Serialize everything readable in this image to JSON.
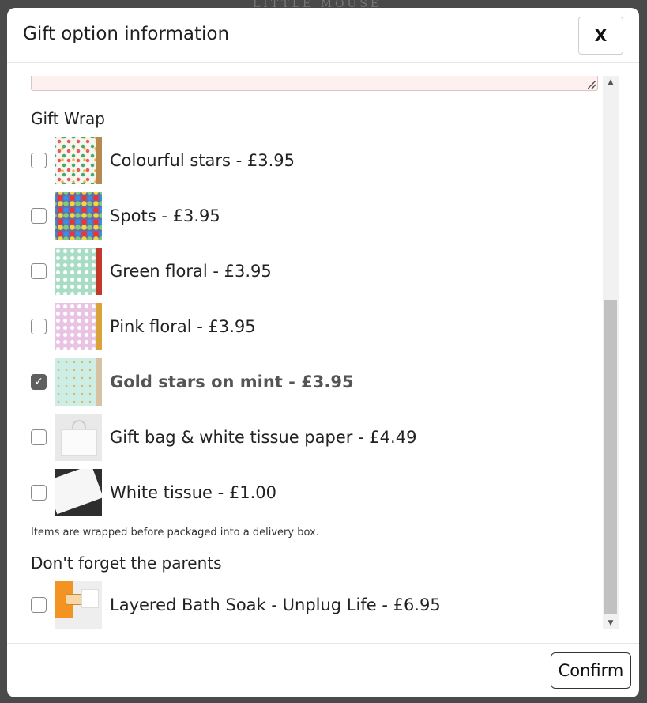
{
  "background": {
    "logo_text": "LITTLE MOUSE"
  },
  "modal": {
    "title": "Gift option information",
    "close_label": "X",
    "confirm_label": "Confirm"
  },
  "gift_wrap": {
    "heading": "Gift Wrap",
    "options": [
      {
        "label": "Colourful stars - £3.95",
        "checked": false,
        "thumb": "colourful-stars"
      },
      {
        "label": "Spots - £3.95",
        "checked": false,
        "thumb": "spots"
      },
      {
        "label": "Green floral - £3.95",
        "checked": false,
        "thumb": "green-floral"
      },
      {
        "label": "Pink floral - £3.95",
        "checked": false,
        "thumb": "pink-floral"
      },
      {
        "label": "Gold stars on mint - £3.95",
        "checked": true,
        "thumb": "gold-stars-mint"
      },
      {
        "label": "Gift bag & white tissue paper - £4.49",
        "checked": false,
        "thumb": "gift-bag"
      },
      {
        "label": "White tissue - £1.00",
        "checked": false,
        "thumb": "white-tissue"
      }
    ],
    "note": "Items are wrapped before packaged into a delivery box."
  },
  "parents": {
    "heading": "Don't forget the parents",
    "options": [
      {
        "label": "Layered Bath Soak - Unplug Life - £6.95",
        "checked": false,
        "thumb": "bath-soak"
      }
    ]
  },
  "icons": {
    "check": "✓",
    "scroll_up": "▲",
    "scroll_down": "▼"
  }
}
